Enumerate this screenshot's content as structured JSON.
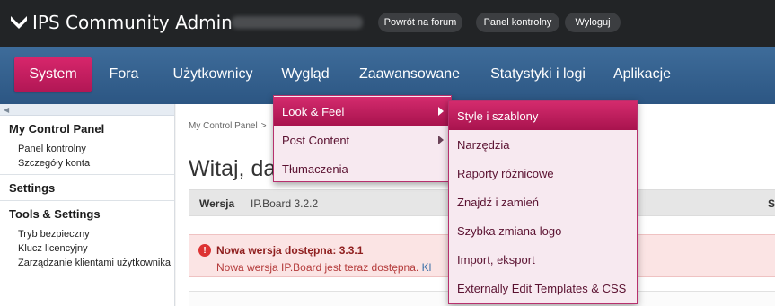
{
  "header": {
    "app_title": "IPS Community Admin",
    "buttons": {
      "forum": "Powrót na forum",
      "panel": "Panel kontrolny",
      "logout": "Wyloguj"
    }
  },
  "nav": {
    "items": [
      "System",
      "Fora",
      "Użytkownicy",
      "Wygląd",
      "Zaawansowane",
      "Statystyki i logi",
      "Aplikacje"
    ],
    "active": "System"
  },
  "sidebar": {
    "my_control_panel": "My Control Panel",
    "mcp_links": [
      "Panel kontrolny",
      "Szczegóły konta"
    ],
    "settings": "Settings",
    "tools_settings": "Tools & Settings",
    "tools_links": [
      "Tryb bezpieczny",
      "Klucz licencyjny",
      "Zarządzanie klientami użytkownika"
    ]
  },
  "main": {
    "breadcrumb": "My Control Panel",
    "breadcrumb_sep": ">",
    "title": "Witaj, da",
    "version_label": "Wersja",
    "version_value": "IP.Board 3.2.2",
    "version_right": "S",
    "alert_title": "Nowa wersja dostępna: 3.3.1",
    "alert_text": "Nowa wersja IP.Board jest teraz dostępna.",
    "alert_link": "Kl"
  },
  "dropdown": {
    "items": [
      "Look & Feel",
      "Post Content",
      "Tłumaczenia"
    ],
    "hovered": "Look & Feel"
  },
  "submenu": {
    "items": [
      "Style i szablony",
      "Narzędzia",
      "Raporty różnicowe",
      "Znajdź i zamień",
      "Szybka zmiana logo",
      "Import, eksport",
      "Externally Edit Templates & CSS"
    ],
    "hovered": "Style i szablony"
  },
  "colors": {
    "accent": "#c21d5f",
    "nav_bg": "#345f8e",
    "top_bg": "#222426"
  }
}
